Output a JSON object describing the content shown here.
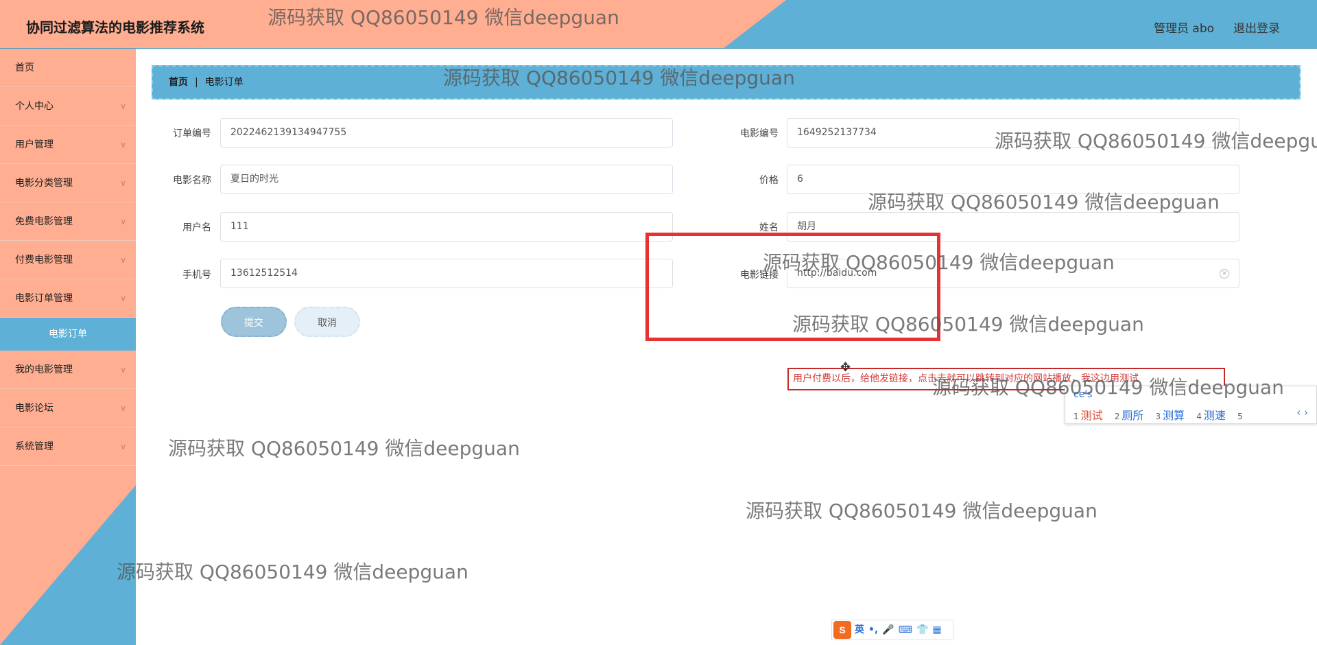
{
  "header": {
    "title": "协同过滤算法的电影推荐系统",
    "admin_label": "管理员 abo",
    "logout_label": "退出登录"
  },
  "sidebar": {
    "items": [
      {
        "label": "首页",
        "has_chevron": false
      },
      {
        "label": "个人中心",
        "has_chevron": true
      },
      {
        "label": "用户管理",
        "has_chevron": true
      },
      {
        "label": "电影分类管理",
        "has_chevron": true
      },
      {
        "label": "免费电影管理",
        "has_chevron": true
      },
      {
        "label": "付费电影管理",
        "has_chevron": true
      },
      {
        "label": "电影订单管理",
        "has_chevron": true
      },
      {
        "label": "我的电影管理",
        "has_chevron": true
      },
      {
        "label": "电影论坛",
        "has_chevron": true
      },
      {
        "label": "系统管理",
        "has_chevron": true
      }
    ],
    "active_sub_item": "电影订单"
  },
  "breadcrumb": {
    "home": "首页",
    "separator": "|",
    "current": "电影订单"
  },
  "form": {
    "order_no": {
      "label": "订单编号",
      "value": "2022462139134947755"
    },
    "movie_no": {
      "label": "电影编号",
      "value": "1649252137734"
    },
    "movie_name": {
      "label": "电影名称",
      "value": "夏日的时光"
    },
    "price": {
      "label": "价格",
      "value": "6"
    },
    "username": {
      "label": "用户名",
      "value": "111"
    },
    "real_name": {
      "label": "姓名",
      "value": "胡月"
    },
    "phone": {
      "label": "手机号",
      "value": "13612512514"
    },
    "movie_link": {
      "label": "电影链接",
      "value": "http://baidu.com"
    },
    "submit_label": "提交",
    "cancel_label": "取消"
  },
  "annotation": {
    "note": "用户付费以后，给他发链接，点击去就可以跳转到对应的网站播放，我这边用测试"
  },
  "ime_popup": {
    "input": "ce's",
    "candidates": [
      {
        "n": "1",
        "text": "测试"
      },
      {
        "n": "2",
        "text": "厕所"
      },
      {
        "n": "3",
        "text": "测算"
      },
      {
        "n": "4",
        "text": "测速"
      },
      {
        "n": "5",
        "text": ""
      }
    ],
    "nav": "‹ ›"
  },
  "ime_toolbar": {
    "logo": "S",
    "mode": "英",
    "punct": "•,",
    "icons": [
      "mic-icon",
      "keyboard-icon",
      "skin-icon",
      "grid-icon"
    ]
  },
  "watermark_text": "源码获取 QQ86050149 微信deepguan",
  "colors": {
    "salmon": "#ffae91",
    "blue": "#5fb0d6",
    "annotation_red": "#e53232"
  }
}
